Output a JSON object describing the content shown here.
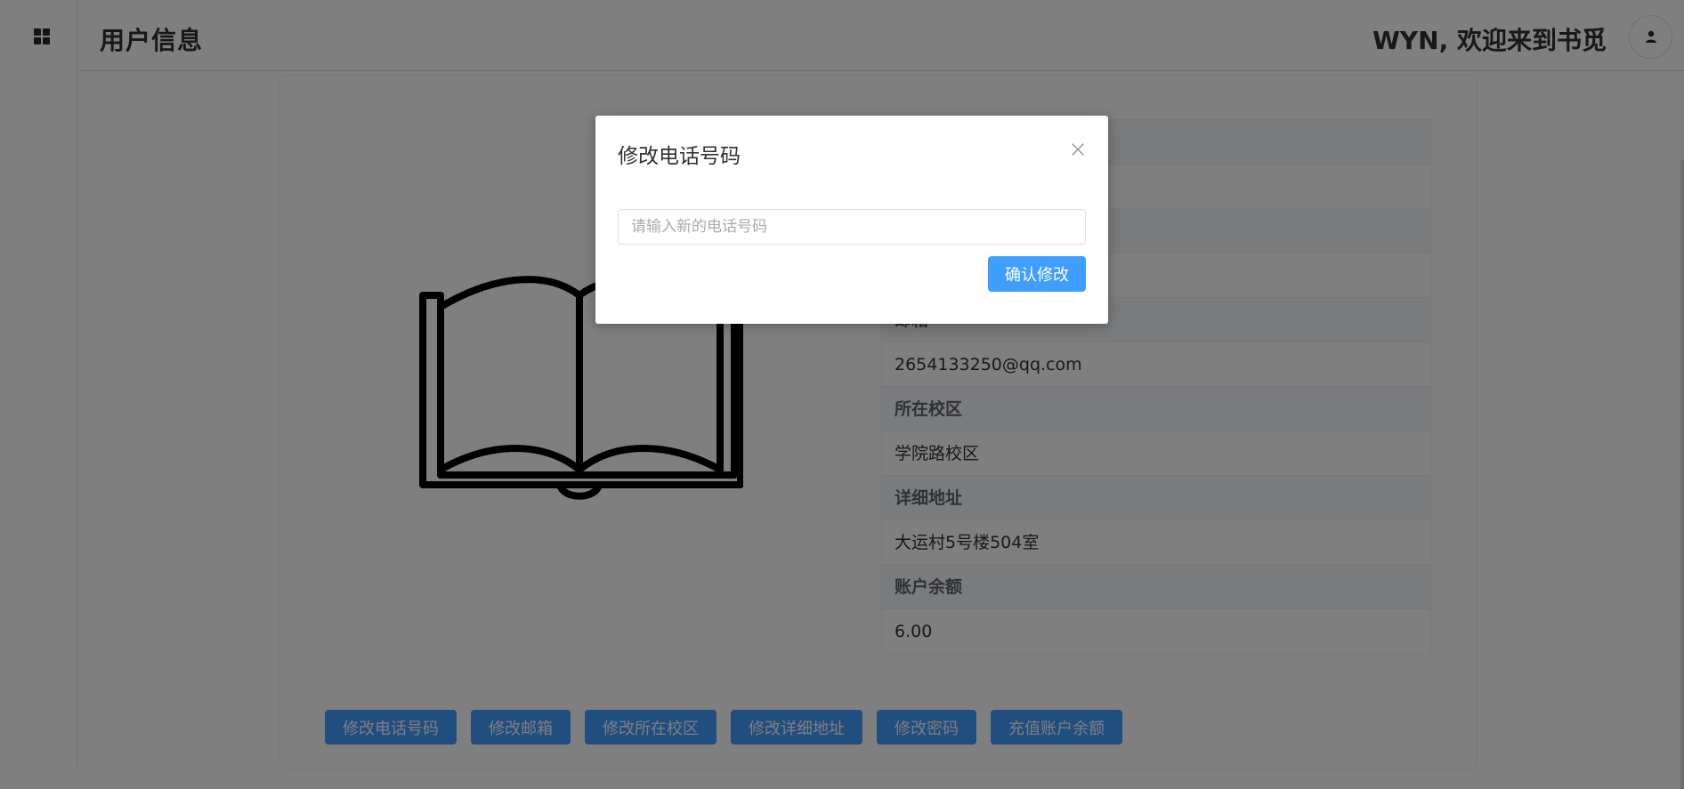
{
  "header": {
    "title": "用户信息",
    "welcome": "WYN, 欢迎来到书觅"
  },
  "rail": {
    "menu_icon": "grid-icon"
  },
  "profile_image": {
    "icon": "open-book-icon"
  },
  "info": {
    "rows": [
      {
        "label": "",
        "value": ""
      },
      {
        "label": "",
        "value": ""
      },
      {
        "label": "邮箱",
        "value": "2654133250@qq.com"
      },
      {
        "label": "所在校区",
        "value": "学院路校区"
      },
      {
        "label": "详细地址",
        "value": "大运村5号楼504室"
      },
      {
        "label": "账户余额",
        "value": "6.00"
      }
    ]
  },
  "actions": [
    "修改电话号码",
    "修改邮箱",
    "修改所在校区",
    "修改详细地址",
    "修改密码",
    "充值账户余额"
  ],
  "dialog": {
    "title": "修改电话号码",
    "input_placeholder": "请输入新的电话号码",
    "input_value": "",
    "confirm_label": "确认修改",
    "close_icon": "close-icon"
  },
  "colors": {
    "primary": "#409eff",
    "overlay": "rgba(0,0,0,0.5)"
  }
}
